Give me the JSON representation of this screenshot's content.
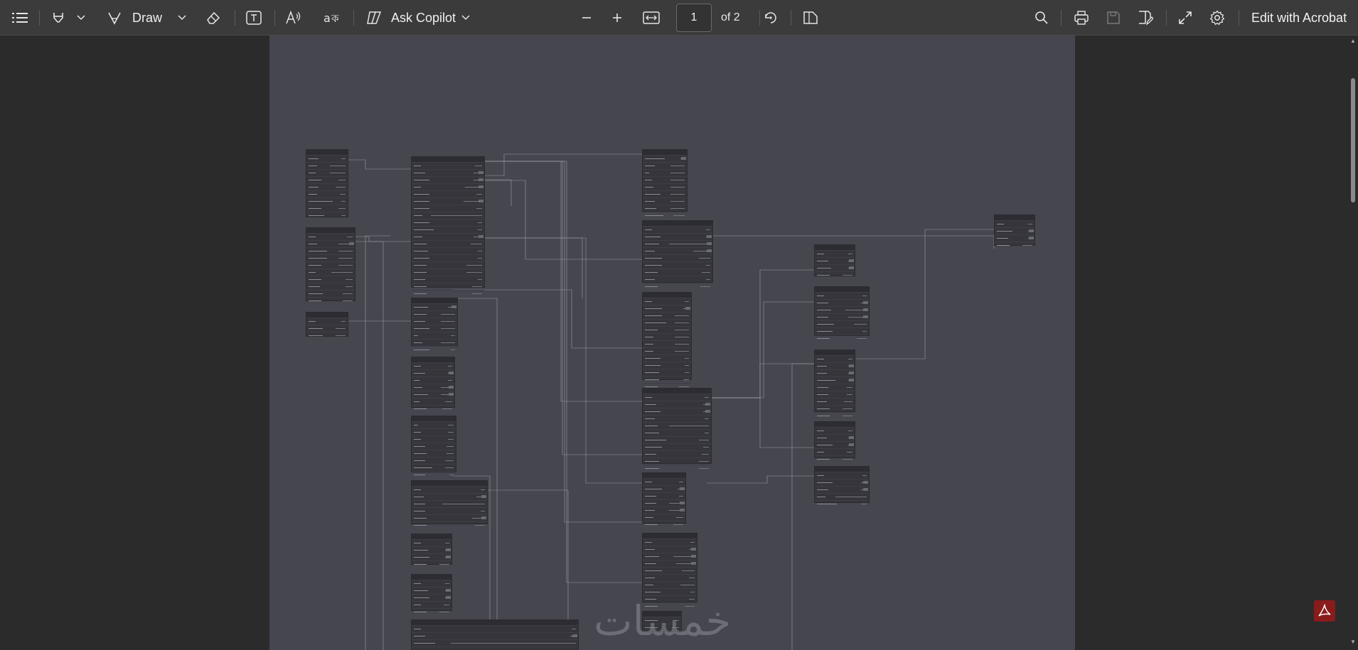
{
  "toolbar": {
    "draw_label": "Draw",
    "ask_copilot_label": "Ask Copilot",
    "page_current": "1",
    "page_total_label": "of 2",
    "edit_acrobat_label": "Edit with Acrobat"
  },
  "icons": {
    "contents": "list-icon",
    "highlight": "highlighter-icon",
    "draw": "pen-icon",
    "erase": "eraser-icon",
    "textbox": "text-box-icon",
    "read_aloud": "read-aloud-icon",
    "translate": "translate-icon",
    "copilot": "copilot-icon",
    "zoom_out": "minus-icon",
    "zoom_in": "plus-icon",
    "fit_width": "fit-width-icon",
    "rotate": "rotate-icon",
    "page_view": "page-view-icon",
    "search": "search-icon",
    "print": "print-icon",
    "save": "save-icon",
    "save_as": "save-as-icon",
    "fullscreen": "fullscreen-icon",
    "settings": "gear-icon",
    "acrobat": "acrobat-icon"
  },
  "colors": {
    "toolbar_bg": "#3b3b3b",
    "page_bg": "#46464f",
    "viewer_bg": "#2b2b2b",
    "acrobat_red": "#8a1b1b"
  },
  "document": {
    "watermark_text": "خمسات"
  }
}
